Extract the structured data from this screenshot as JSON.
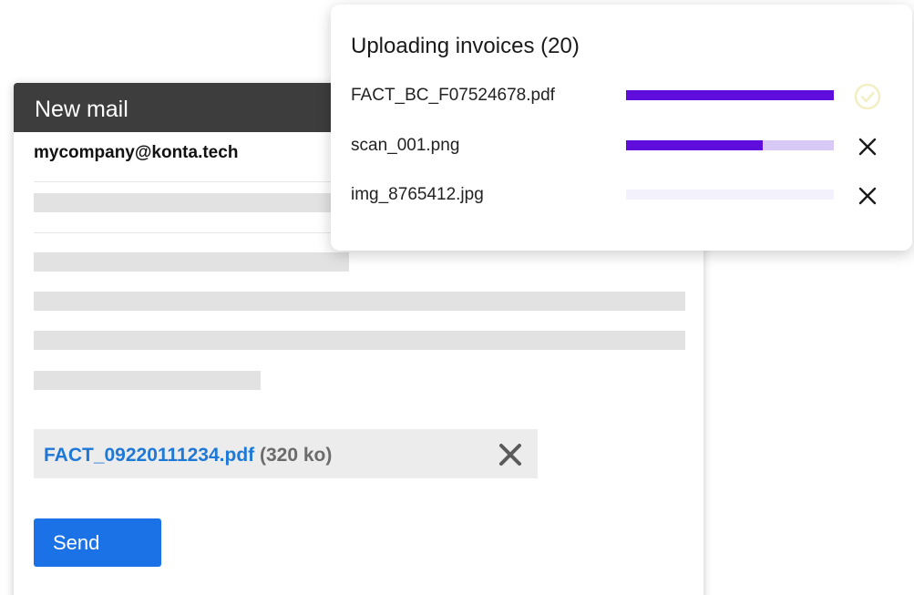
{
  "mail": {
    "title": "New mail",
    "recipient": "mycompany@konta.tech",
    "attachment": {
      "name": "FACT_09220111234.pdf",
      "size": "(320 ko)"
    },
    "send_label": "Send"
  },
  "upload": {
    "title": "Uploading invoices (20)",
    "files": [
      {
        "name": "FACT_BC_F07524678.pdf",
        "progress": 1.0,
        "status": "complete",
        "action_icon": "check-circle-icon",
        "track_color": "#e9dcfb",
        "action_color": "#f3efc4"
      },
      {
        "name": "scan_001.png",
        "progress": 0.66,
        "status": "uploading",
        "action_icon": "close-icon",
        "track_color": "#d8c8f5",
        "action_color": "#1a1a1a"
      },
      {
        "name": "img_8765412.jpg",
        "progress": 0.0,
        "status": "pending",
        "action_icon": "close-icon",
        "track_color": "#f3f1fb",
        "action_color": "#1a1a1a"
      }
    ]
  },
  "colors": {
    "accent_purple": "#5e0ddd",
    "link_blue": "#1e78d7",
    "send_blue": "#1a72e6",
    "header_dark": "#3d3d3d"
  }
}
